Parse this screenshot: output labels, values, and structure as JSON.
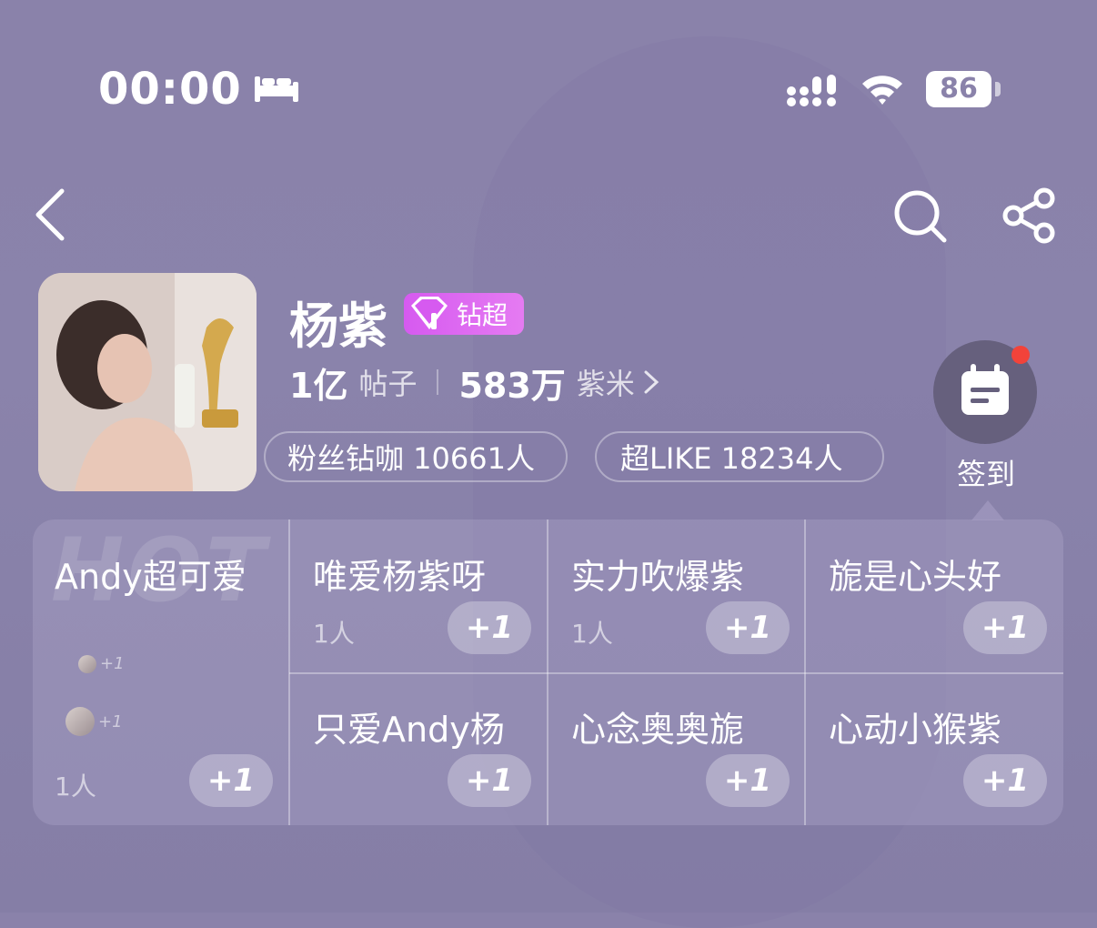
{
  "status_bar": {
    "time": "00:00",
    "battery": "86"
  },
  "profile": {
    "name": "杨紫",
    "badge": "钻超",
    "posts_num": "1亿",
    "posts_label": "帖子",
    "fans_num": "583万",
    "fans_label": "紫米",
    "pill_fan": "粉丝钻咖 10661人",
    "pill_like": "超LIKE 18234人"
  },
  "checkin": {
    "label": "签到"
  },
  "panel": {
    "watermark": "HOT",
    "plus_label": "+1",
    "cells": [
      {
        "title": "Andy超可爱",
        "count": "1人"
      },
      {
        "title": "唯爱杨紫呀",
        "count": "1人"
      },
      {
        "title": "实力吹爆紫",
        "count": "1人"
      },
      {
        "title": "旎是心头好",
        "count": ""
      },
      {
        "title": "只爱Andy杨",
        "count": ""
      },
      {
        "title": "心念奥奥旎",
        "count": ""
      },
      {
        "title": "心动小猴紫",
        "count": ""
      }
    ],
    "mini_plus": "+1"
  },
  "colors": {
    "badge": "#d65af0",
    "notify": "#f2433a",
    "bg": "#8a82aa"
  }
}
